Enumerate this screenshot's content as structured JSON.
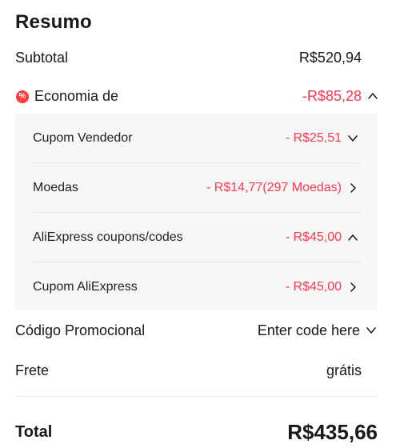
{
  "summary": {
    "title": "Resumo",
    "subtotal": {
      "label": "Subtotal",
      "value": "R$520,94"
    },
    "savings": {
      "badge_icon": "discount-badge-icon",
      "badge_glyph": "%",
      "label": "Economia de",
      "value": "-R$85,28",
      "expanded": true
    },
    "discounts": [
      {
        "label": "Cupom Vendedor",
        "value": "- R$25,51",
        "chevron": "down"
      },
      {
        "label": "Moedas",
        "value": "- R$14,77(297 Moedas)",
        "chevron": "right"
      },
      {
        "label": "AliExpress coupons/codes",
        "value": "- R$45,00",
        "chevron": "up"
      },
      {
        "label": "Cupom AliExpress",
        "value": "- R$45,00",
        "chevron": "right"
      }
    ],
    "promo_code": {
      "label": "Código Promocional",
      "placeholder": "Enter code here"
    },
    "shipping": {
      "label": "Frete",
      "value": "grátis"
    },
    "total": {
      "label": "Total",
      "value": "R$435,66"
    }
  },
  "colors": {
    "discount_red": "#fd384f",
    "text": "#191919",
    "panel_bg": "#f7f7f7"
  }
}
